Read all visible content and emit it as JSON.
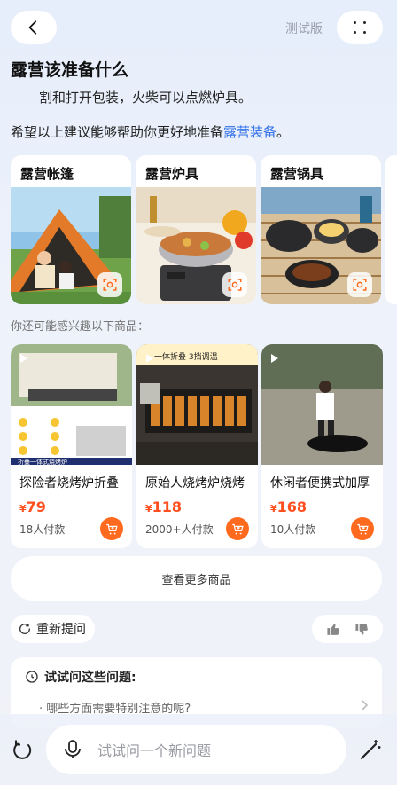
{
  "header": {
    "test_label": "测试版"
  },
  "answer": {
    "title": "露营该准备什么",
    "line1": "割和打开包装，火柴可以点燃炉具。",
    "line2_prefix": "希望以上建议能够帮助你更好地准备",
    "line2_link": "露营装备",
    "line2_suffix": "。"
  },
  "categories": [
    {
      "label": "露营帐篷"
    },
    {
      "label": "露营炉具"
    },
    {
      "label": "露营锅具"
    }
  ],
  "maybe_label": "你还可能感兴趣以下商品：",
  "products": [
    {
      "name": "探险者烧烤炉折叠",
      "currency": "¥",
      "price": "79",
      "sold": "18人付款",
      "image_caption": "折叠一体式烧烤炉"
    },
    {
      "name": "原始人烧烤炉烧烤",
      "currency": "¥",
      "price": "118",
      "sold": "2000+人付款",
      "image_caption": "一体折叠 3挡调温"
    },
    {
      "name": "休闲者便携式加厚",
      "currency": "¥",
      "price": "168",
      "sold": "10人付款"
    }
  ],
  "see_more_label": "查看更多商品",
  "reask_label": "重新提问",
  "suggest": {
    "title": "试试问这些问题:",
    "items": [
      "· 哪些方面需要特别注意的呢?"
    ]
  },
  "input": {
    "placeholder": "试试问一个新问题"
  },
  "colors": {
    "accent": "#2f6fe8",
    "price": "#ff4f1f",
    "cart": "#ff6a1f"
  }
}
